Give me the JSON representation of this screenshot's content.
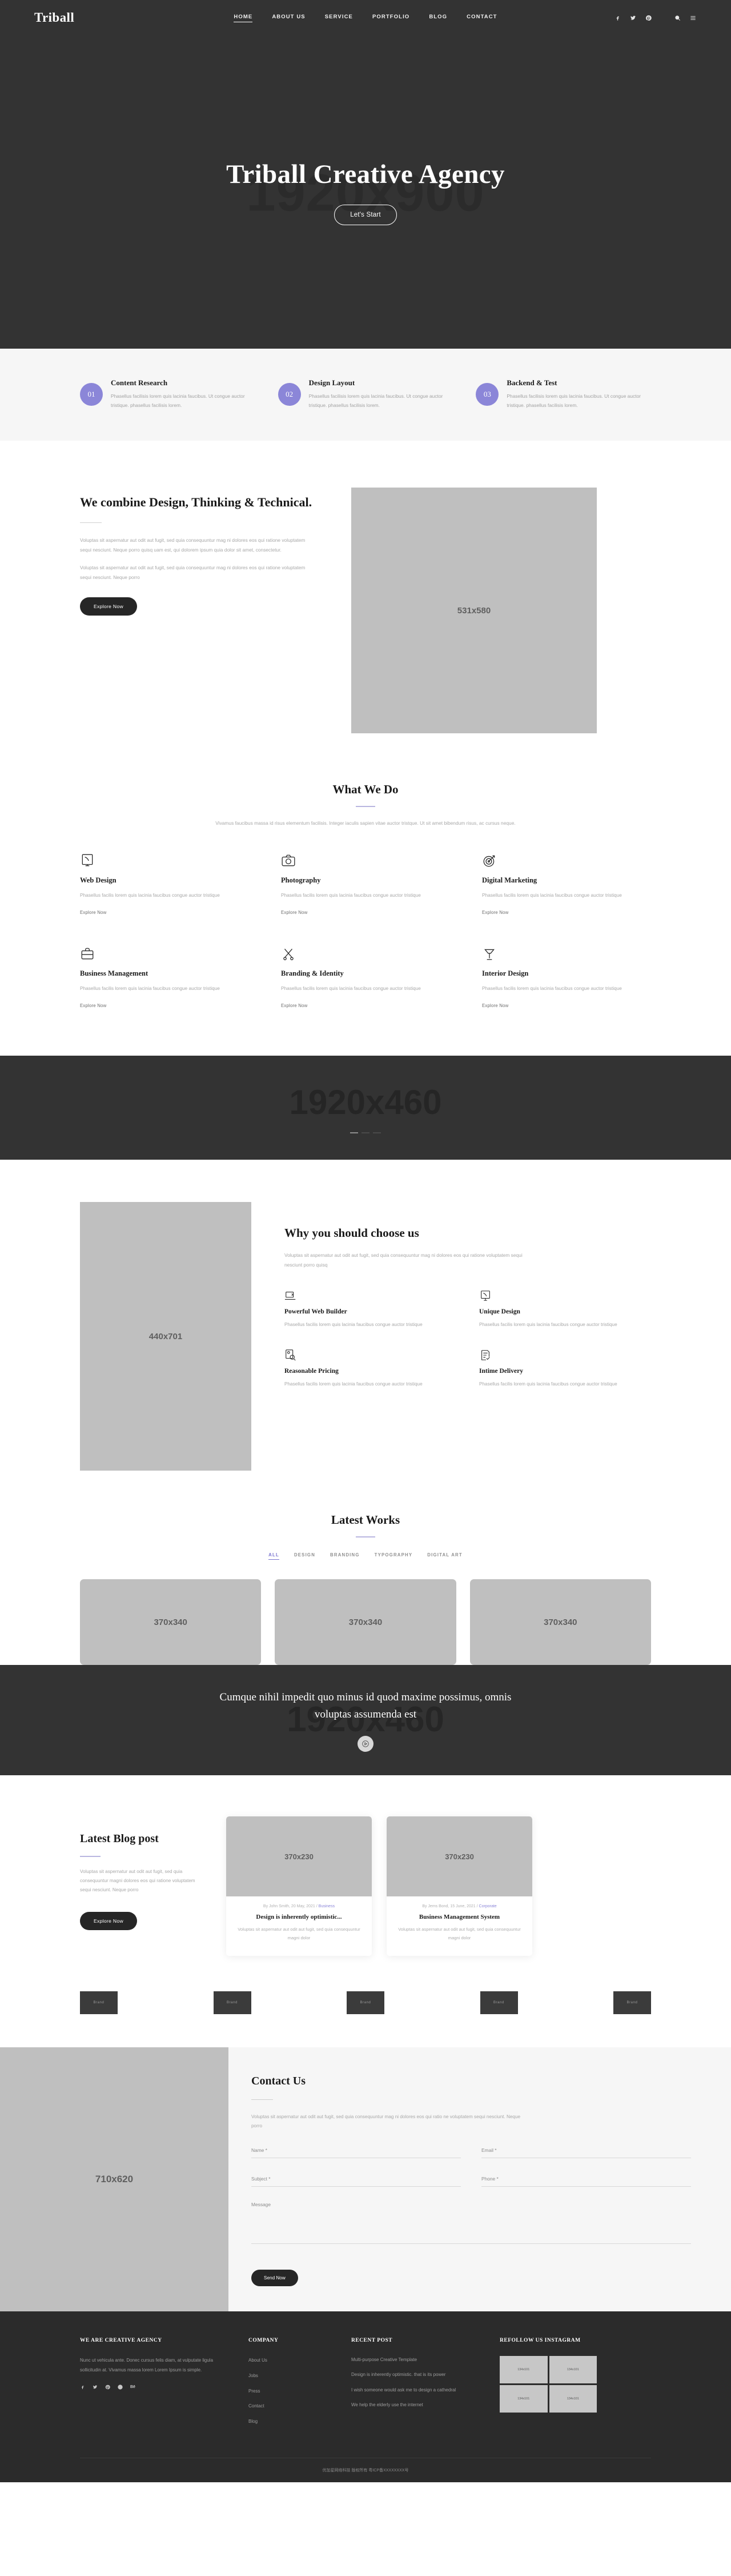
{
  "header": {
    "brand": "Triball",
    "nav": [
      {
        "label": "HOME",
        "active": true
      },
      {
        "label": "ABOUT US",
        "active": false
      },
      {
        "label": "SERVICE",
        "active": false
      },
      {
        "label": "PORTFOLIO",
        "active": false
      },
      {
        "label": "BLOG",
        "active": false
      },
      {
        "label": "CONTACT",
        "active": false
      }
    ],
    "icons": [
      "facebook-icon",
      "twitter-icon",
      "pinterest-icon",
      "search-icon",
      "hamburger-menu-icon"
    ]
  },
  "hero": {
    "placeholder": "1920x900",
    "title": "Triball Creative Agency",
    "cta": "Let's Start"
  },
  "steps": [
    {
      "num": "01",
      "title": "Content Research",
      "text": "Phasellus facilisis lorem quis lacinia faucibus. Ut congue auctor tristique. phasellus facilisis lorem."
    },
    {
      "num": "02",
      "title": "Design Layout",
      "text": "Phasellus facilisis lorem quis lacinia faucibus. Ut congue auctor tristique. phasellus facilisis lorem."
    },
    {
      "num": "03",
      "title": "Backend & Test",
      "text": "Phasellus facilisis lorem quis lacinia faucibus. Ut congue auctor tristique. phasellus facilisis lorem."
    }
  ],
  "combine": {
    "title": "We combine Design, Thinking & Technical.",
    "p1": "Voluptas sit aspernatur aut odit aut fugit, sed quia consequuntur mag ni dolores eos qui ratione voluptatem sequi nesciunt. Neque porro quisq uam est, qui dolorem ipsum quia dolor sit amet, consectetur.",
    "p2": "Voluptas sit aspernatur aut odit aut fugit, sed quia consequuntur mag ni dolores eos qui ratione voluptatem sequi nesciunt. Neque porro",
    "button": "Explore Now",
    "image_placeholder": "531x580"
  },
  "whatwedo": {
    "title": "What We Do",
    "subtitle": "Vivamus faucibus massa id risus elementum facilisis. Integer iaculis sapien vitae auctor tristque. Ut sit amet bibendum risus, ac cursus neque.",
    "services": [
      {
        "icon": "web-design-icon",
        "title": "Web Design",
        "text": "Phasellus facilis lorem quis lacinia faucibus congue auctor tristique",
        "link": "Explore Now"
      },
      {
        "icon": "camera-icon",
        "title": "Photography",
        "text": "Phasellus facilis lorem quis lacinia faucibus congue auctor tristique",
        "link": "Explore Now"
      },
      {
        "icon": "target-icon",
        "title": "Digital Marketing",
        "text": "Phasellus facilis lorem quis lacinia faucibus congue auctor tristique",
        "link": "Explore Now"
      },
      {
        "icon": "briefcase-icon",
        "title": "Business Management",
        "text": "Phasellus facilis lorem quis lacinia faucibus congue auctor tristique",
        "link": "Explore Now"
      },
      {
        "icon": "scissors-icon",
        "title": "Branding & Identity",
        "text": "Phasellus facilis lorem quis lacinia faucibus congue auctor tristique",
        "link": "Explore Now"
      },
      {
        "icon": "lamp-icon",
        "title": "Interior Design",
        "text": "Phasellus facilis lorem quis lacinia faucibus congue auctor tristique",
        "link": "Explore Now"
      }
    ]
  },
  "banner": {
    "placeholder": "1920x460"
  },
  "why": {
    "image_placeholder": "440x701",
    "title": "Why you should choose us",
    "subtitle": "Voluptas sit aspernatur aut odit aut fugit, sed quia consequuntur mag ni dolores eos qui ratione voluptatem sequi nesciunt porro quisq",
    "features": [
      {
        "icon": "laptop-code-icon",
        "title": "Powerful Web Builder",
        "text": "Phasellus facilis lorem quis lacinia faucibus congue auctor tristique"
      },
      {
        "icon": "monitor-design-icon",
        "title": "Unique Design",
        "text": "Phasellus facilis lorem quis lacinia faucibus congue auctor tristique"
      },
      {
        "icon": "price-tag-icon",
        "title": "Reasonable Pricing",
        "text": "Phasellus facilis lorem quis lacinia faucibus congue auctor tristique"
      },
      {
        "icon": "checklist-icon",
        "title": "Intime Delivery",
        "text": "Phasellus facilis lorem quis lacinia faucibus congue auctor tristique"
      }
    ]
  },
  "works": {
    "title": "Latest Works",
    "filters": [
      {
        "label": "ALL",
        "active": true
      },
      {
        "label": "DESIGN",
        "active": false
      },
      {
        "label": "BRANDING",
        "active": false
      },
      {
        "label": "TYPOGRAPHY",
        "active": false
      },
      {
        "label": "DIGITAL ART",
        "active": false
      }
    ],
    "items": [
      "370x340",
      "370x340",
      "370x340"
    ]
  },
  "cta": {
    "placeholder": "1920x460",
    "headline": "Cumque nihil impedit quo minus id quod maxime possimus, omnis voluptas assumenda est",
    "play": "play-icon"
  },
  "blog": {
    "title": "Latest Blog post",
    "text": "Voluptas sit aspernatur aut odit aut fugit, sed quia consequuntur magni dolores eos qui ratione voluptatem sequi nesciunt. Neque porro",
    "button": "Explore Now",
    "posts": [
      {
        "image": "370x230",
        "meta_prefix": "By John Smith, 20 May, 2021 / ",
        "meta_cat": "Business",
        "title": "Design is inherently optimistic...",
        "text": "Voluptas sit aspernatur aut odit aut fugit, sed quia consequuntur magni dolor"
      },
      {
        "image": "370x230",
        "meta_prefix": "By Jems Bond, 15 June, 2021 / ",
        "meta_cat": "Corporate",
        "title": "Business Management System",
        "text": "Voluptas sit aspernatur aut odit aut fugit, sed quia consequuntur magni dolor"
      }
    ]
  },
  "clients": [
    "Brand",
    "Brand",
    "Brand",
    "Brand",
    "Brand"
  ],
  "contact": {
    "image_placeholder": "710x620",
    "title": "Contact Us",
    "text": "Voluptas sit aspernatur aut odit aut fugit, sed quia consequuntur mag ni dolores eos qui ratio ne voluptatem sequi nesciunt. Neque porro",
    "fields": {
      "name": "Name *",
      "email": "Email *",
      "subject": "Subject *",
      "phone": "Phone *",
      "message": "Message"
    },
    "submit": "Send Now"
  },
  "footer": {
    "about": {
      "title": "WE ARE CREATIVE AGENCY",
      "text": "Nunc ut vehicula ante. Donec cursus felis diam, at vulputate ligula sollicitudin at. Vivamus massa lorem Lorem Ipsum is simple.",
      "socials": [
        "facebook-icon",
        "twitter-icon",
        "pinterest-icon",
        "dribbble-icon",
        "behance-icon"
      ]
    },
    "company": {
      "title": "COMPANY",
      "links": [
        "About Us",
        "Jobs",
        "Press",
        "Contact",
        "Blog"
      ]
    },
    "recent": {
      "title": "RECENT POST",
      "posts": [
        "Multi-purpose Creative Template",
        "Design is inherently optimistic. that is its power",
        "I wish someone would ask me to design a cathedral",
        "We help the elderly use the internet"
      ]
    },
    "instagram": {
      "title": "REFOLLOW US INSTAGRAM",
      "cells": [
        "134x101",
        "134x101",
        "134x101",
        "134x101"
      ]
    },
    "copyright": "优加星网络科技 版权所有 粤ICP备XXXXXXXX号"
  },
  "colors": {
    "dark": "#333333",
    "accent": "#8b86d8",
    "light_bg": "#f6f6f6",
    "placeholder": "#bfbfbf"
  }
}
